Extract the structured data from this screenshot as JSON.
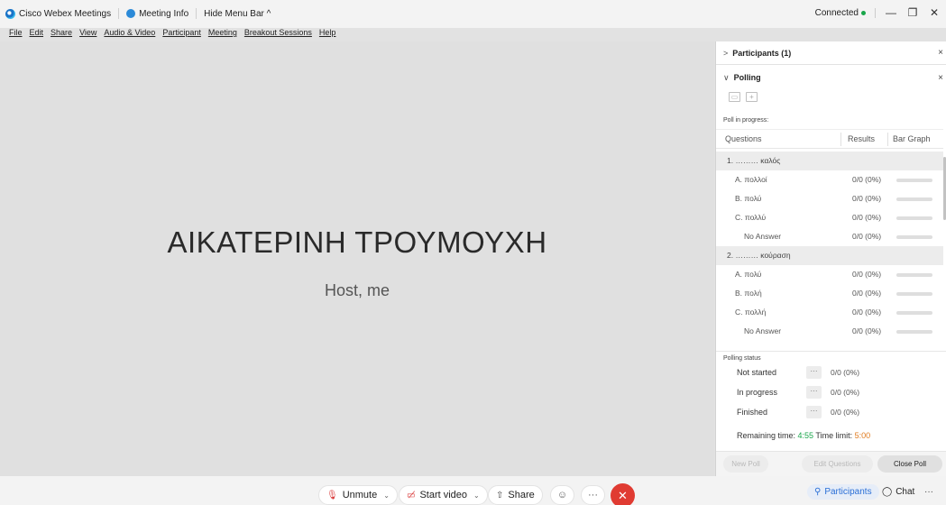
{
  "titlebar": {
    "app_name": "Cisco Webex Meetings",
    "meeting_info": "Meeting Info",
    "hide_menu": "Hide Menu Bar ^",
    "connection": "Connected",
    "minimize": "—",
    "restore": "❐",
    "close": "✕"
  },
  "menu": [
    "File",
    "Edit",
    "Share",
    "View",
    "Audio & Video",
    "Participant",
    "Meeting",
    "Breakout Sessions",
    "Help"
  ],
  "stage": {
    "name": "ΑΙΚΑΤΕΡΙΝΗ ΤΡΟΥΜΟΥΧΗ",
    "role": "Host, me"
  },
  "panel": {
    "participants_header": "Participants (1)",
    "polling_header": "Polling",
    "poll_in_progress": "Poll in progress:",
    "columns": {
      "questions": "Questions",
      "results": "Results",
      "bar_graph": "Bar Graph"
    },
    "rows": [
      {
        "type": "question",
        "label": "1. ……… καλός"
      },
      {
        "type": "answer",
        "label": "A.  πολλοί",
        "result": "0/0 (0%)"
      },
      {
        "type": "answer",
        "label": "B.  πολύ",
        "result": "0/0 (0%)"
      },
      {
        "type": "answer",
        "label": "C.  πολλύ",
        "result": "0/0 (0%)"
      },
      {
        "type": "noans",
        "label": "No Answer",
        "result": "0/0 (0%)"
      },
      {
        "type": "question",
        "label": "2. ……… κούραση"
      },
      {
        "type": "answer",
        "label": "A.  πολύ",
        "result": "0/0 (0%)"
      },
      {
        "type": "answer",
        "label": "B.  πολή",
        "result": "0/0 (0%)"
      },
      {
        "type": "answer",
        "label": "C.  πολλή",
        "result": "0/0 (0%)"
      },
      {
        "type": "noans",
        "label": "No Answer",
        "result": "0/0 (0%)"
      }
    ],
    "polling_status": "Polling status",
    "status_rows": [
      {
        "name": "Not started",
        "value": "0/0 (0%)"
      },
      {
        "name": "In progress",
        "value": "0/0 (0%)"
      },
      {
        "name": "Finished",
        "value": "0/0 (0%)"
      }
    ],
    "remaining_label": "Remaining time:",
    "remaining_value": "4:55",
    "limit_label": "Time limit:",
    "limit_value": "5:00",
    "new_poll": "New Poll",
    "edit_questions": "Edit Questions",
    "close_poll": "Close Poll"
  },
  "controls": {
    "unmute": "Unmute",
    "start_video": "Start video",
    "share": "Share",
    "participants": "Participants",
    "chat": "Chat"
  },
  "colors": {
    "accent": "#2a6fd6",
    "leave": "#e03b32",
    "connected": "#19a64a",
    "timer_remaining": "#19a64a",
    "timer_limit": "#e07b1f"
  }
}
